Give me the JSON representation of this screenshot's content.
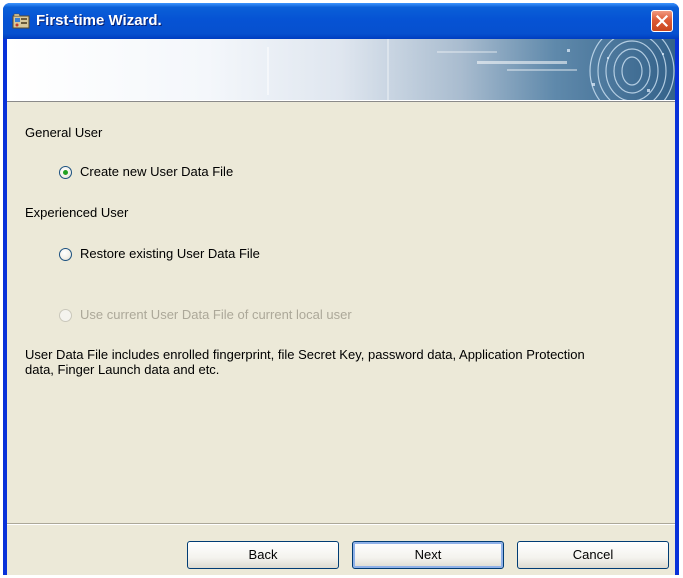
{
  "window": {
    "title": "First-time Wizard."
  },
  "sections": {
    "general_user": "General User",
    "experienced_user": "Experienced User"
  },
  "options": {
    "create_new": {
      "label": "Create new User Data File",
      "selected": true,
      "enabled": true
    },
    "restore_existing": {
      "label": "Restore existing User Data File",
      "selected": false,
      "enabled": true
    },
    "use_current": {
      "label": "Use current User Data File of current local user",
      "selected": false,
      "enabled": false
    }
  },
  "info_text": "User Data File includes enrolled fingerprint, file Secret Key, password data, Application Protection data, Finger Launch data and etc.",
  "buttons": {
    "back": "Back",
    "next": "Next",
    "cancel": "Cancel"
  },
  "colors": {
    "titlebar": "#0653d4",
    "dialog_bg": "#ece9d8",
    "close_button": "#dd5a35",
    "radio_dot": "#21a121"
  },
  "icons": {
    "title_icon": "wizard-app-icon",
    "close": "close-icon",
    "banner": "fingerprint-banner-graphic"
  }
}
